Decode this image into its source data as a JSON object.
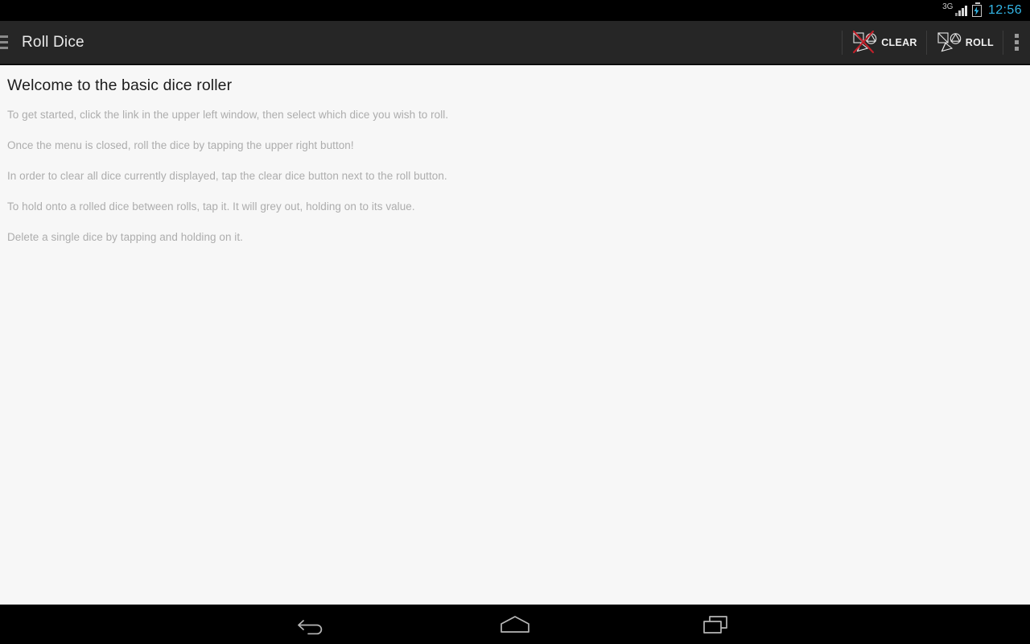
{
  "status_bar": {
    "network_type": "3G",
    "signal_icon": "signal-bars-icon",
    "battery_icon": "battery-charging-icon",
    "time": "12:56",
    "time_color": "#33b5e5"
  },
  "action_bar": {
    "drawer_icon": "hamburger-menu-icon",
    "title": "Roll Dice",
    "background_color": "#262626",
    "actions": [
      {
        "label": "CLEAR",
        "icon": "dice-cleared-icon",
        "accent_color": "#c0202a"
      },
      {
        "label": "ROLL",
        "icon": "dice-icon"
      }
    ],
    "overflow_icon": "overflow-menu-icon"
  },
  "content": {
    "background_color": "#f7f7f7",
    "heading": "Welcome to the basic dice roller",
    "instructions": [
      "To get started, click the link in the upper left window, then select which dice you wish to roll.",
      "Once the menu is closed, roll the dice by tapping the upper right button!",
      "In order to clear all dice currently displayed, tap the clear dice button next to the roll button.",
      "To hold onto a rolled dice between rolls, tap it. It will grey out, holding on to its value.",
      "Delete a single dice by tapping and holding on it."
    ]
  },
  "nav_bar": {
    "background_color": "#000000",
    "buttons": [
      {
        "name": "back-icon"
      },
      {
        "name": "home-icon"
      },
      {
        "name": "recent-apps-icon"
      }
    ]
  }
}
